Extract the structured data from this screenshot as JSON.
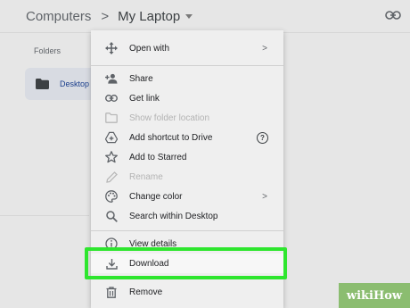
{
  "breadcrumb": {
    "root": "Computers",
    "separator": ">",
    "current": "My Laptop"
  },
  "sidebar": {
    "folders_label": "Folders",
    "folder_name": "Desktop"
  },
  "menu": {
    "items": [
      {
        "label": "Open with",
        "icon": "move-arrows-icon",
        "trailing": ">"
      },
      {
        "label": "Share",
        "icon": "person-add-icon"
      },
      {
        "label": "Get link",
        "icon": "link-icon"
      },
      {
        "label": "Show folder location",
        "icon": "folder-icon",
        "disabled": true
      },
      {
        "label": "Add shortcut to Drive",
        "icon": "drive-shortcut-icon",
        "trailing_icon": "help-icon",
        "help": "?"
      },
      {
        "label": "Add to Starred",
        "icon": "star-icon"
      },
      {
        "label": "Rename",
        "icon": "pencil-icon",
        "disabled": true
      },
      {
        "label": "Change color",
        "icon": "palette-icon",
        "trailing": ">"
      },
      {
        "label": "Search within Desktop",
        "icon": "search-icon"
      },
      {
        "label": "View details",
        "icon": "info-icon"
      },
      {
        "label": "Download",
        "icon": "download-icon",
        "highlighted": true
      },
      {
        "label": "Remove",
        "icon": "trash-icon"
      }
    ]
  },
  "colors": {
    "highlight": "#2ee62e",
    "watermark_bg": "#8bbd70"
  },
  "watermark": {
    "text": "wikiHow"
  }
}
